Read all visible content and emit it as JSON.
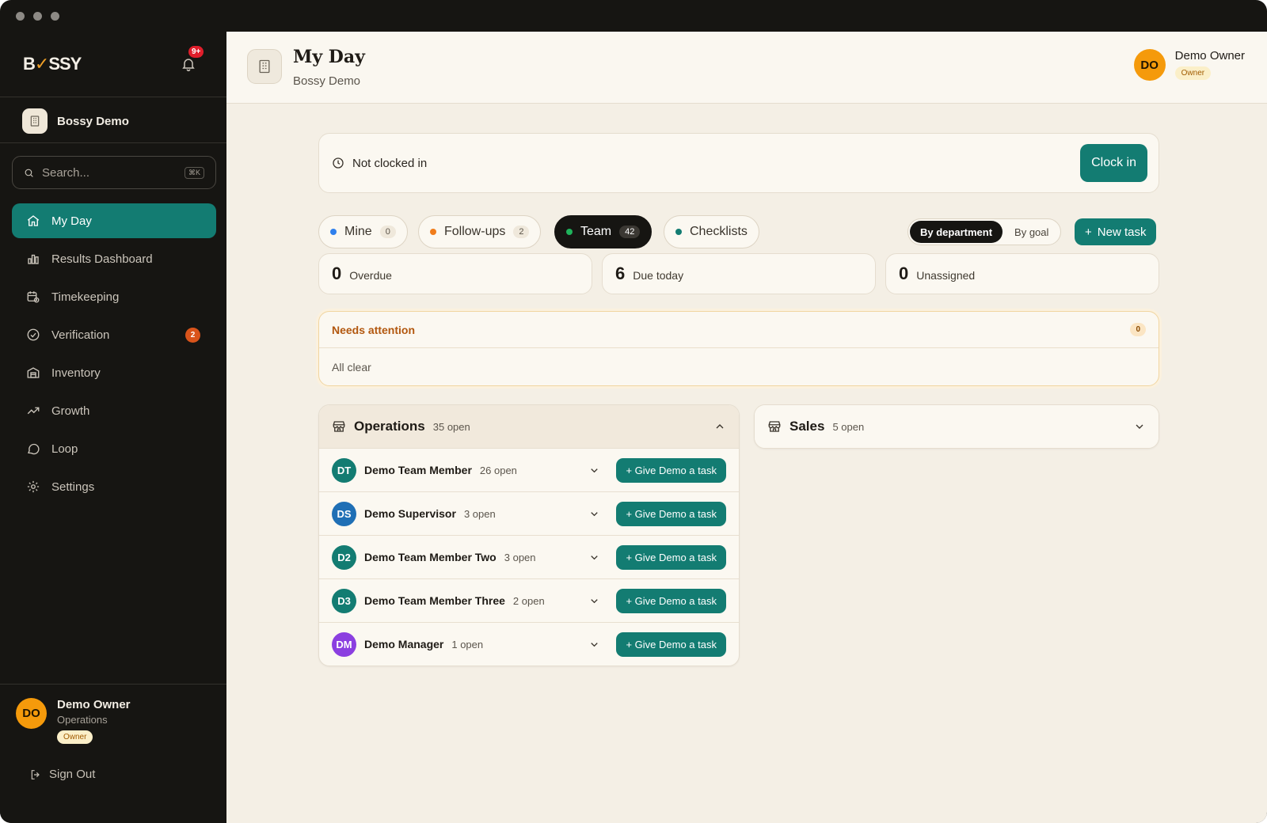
{
  "app": {
    "brand_pre": "B",
    "brand_mark": "✓",
    "brand_post": "SSY",
    "notifications": "9+"
  },
  "sidebar": {
    "org_name": "Bossy Demo",
    "search_placeholder": "Search...",
    "search_shortcut": "⌘K",
    "items": [
      {
        "label": "My Day",
        "icon": "home-icon",
        "active": true
      },
      {
        "label": "Results Dashboard",
        "icon": "bar-chart-icon"
      },
      {
        "label": "Timekeeping",
        "icon": "calendar-clock-icon"
      },
      {
        "label": "Verification",
        "icon": "check-circle-icon",
        "badge": "2"
      },
      {
        "label": "Inventory",
        "icon": "warehouse-icon"
      },
      {
        "label": "Growth",
        "icon": "trend-up-icon"
      },
      {
        "label": "Loop",
        "icon": "chat-bubble-icon"
      },
      {
        "label": "Settings",
        "icon": "gear-icon"
      }
    ],
    "user": {
      "initials": "DO",
      "name": "Demo Owner",
      "dept": "Operations",
      "role": "Owner"
    },
    "sign_out": "Sign Out"
  },
  "header": {
    "title": "My Day",
    "subtitle": "Bossy Demo",
    "user_initials": "DO",
    "user_name": "Demo Owner",
    "user_role": "Owner"
  },
  "clock": {
    "status": "Not clocked in",
    "button": "Clock in"
  },
  "tabs": [
    {
      "label": "Mine",
      "count": "0",
      "color": "#2f80ed"
    },
    {
      "label": "Follow-ups",
      "count": "2",
      "color": "#f07c1a"
    },
    {
      "label": "Team",
      "count": "42",
      "color": "#1fb35b",
      "active": true
    },
    {
      "label": "Checklists",
      "color": "#137c72"
    }
  ],
  "group_toggle": {
    "by_department": "By department",
    "by_goal": "By goal"
  },
  "new_task": {
    "icon": "+",
    "label": "New task"
  },
  "stats": [
    {
      "value": "0",
      "label": "Overdue"
    },
    {
      "value": "6",
      "label": "Due today"
    },
    {
      "value": "0",
      "label": "Unassigned"
    }
  ],
  "attention": {
    "title": "Needs attention",
    "count": "0",
    "body": "All clear"
  },
  "departments": [
    {
      "name": "Operations",
      "open": "35 open",
      "expanded": true,
      "members": [
        {
          "initials": "DT",
          "name": "Demo Team Member",
          "open": "26 open",
          "color": "#137c72",
          "action": "+ Give Demo a task"
        },
        {
          "initials": "DS",
          "name": "Demo Supervisor",
          "open": "3 open",
          "color": "#1f6fb5",
          "action": "+ Give Demo a task"
        },
        {
          "initials": "D2",
          "name": "Demo Team Member Two",
          "open": "3 open",
          "color": "#137c72",
          "action": "+ Give Demo a task"
        },
        {
          "initials": "D3",
          "name": "Demo Team Member Three",
          "open": "2 open",
          "color": "#137c72",
          "action": "+ Give Demo a task"
        },
        {
          "initials": "DM",
          "name": "Demo Manager",
          "open": "1 open",
          "color": "#8b3fe0",
          "action": "+ Give Demo a task"
        }
      ]
    },
    {
      "name": "Sales",
      "open": "5 open",
      "expanded": false,
      "members": []
    }
  ]
}
